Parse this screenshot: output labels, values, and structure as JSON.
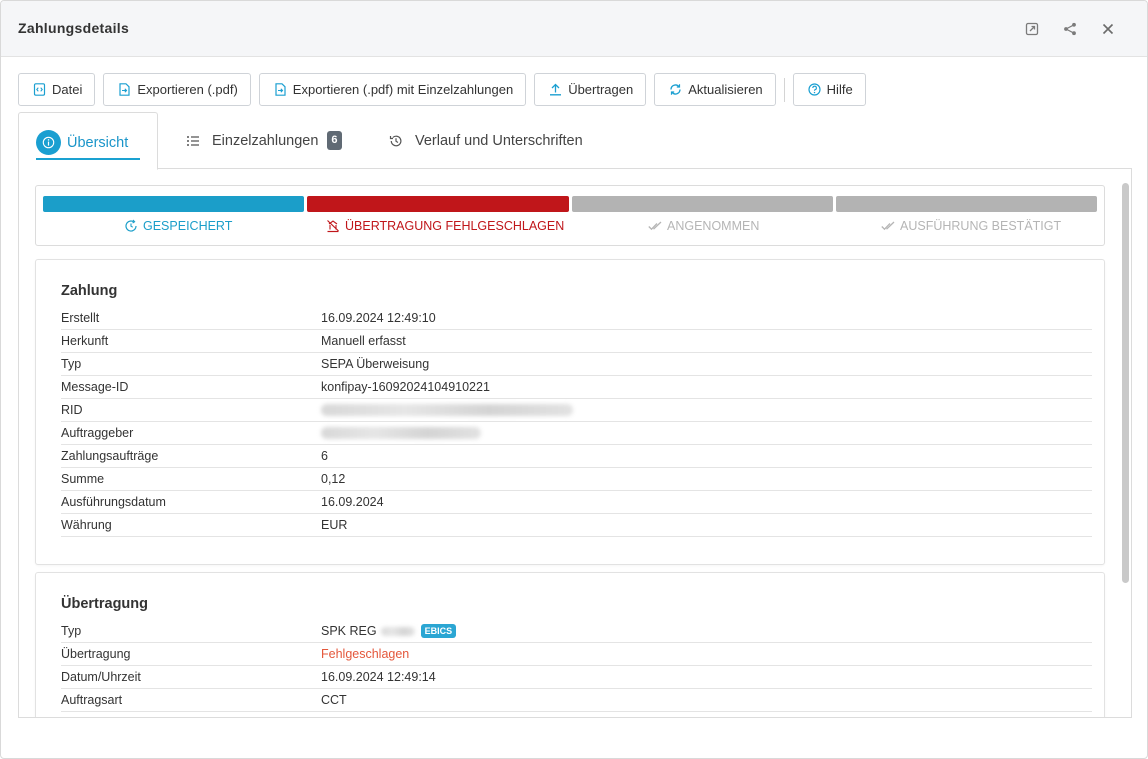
{
  "window": {
    "title": "Zahlungsdetails"
  },
  "toolbar": [
    {
      "label": "Datei",
      "icon": "file-code-icon"
    },
    {
      "label": "Exportieren (.pdf)",
      "icon": "file-export-icon"
    },
    {
      "label": "Exportieren (.pdf) mit Einzelzahlungen",
      "icon": "file-export-icon"
    },
    {
      "label": "Übertragen",
      "icon": "upload-icon"
    },
    {
      "label": "Aktualisieren",
      "icon": "refresh-icon"
    },
    {
      "label": "Hilfe",
      "icon": "help-icon"
    }
  ],
  "tabs": [
    {
      "label": "Übersicht",
      "icon": "info-icon",
      "active": true
    },
    {
      "label": "Einzelzahlungen",
      "icon": "list-icon",
      "count": "6"
    },
    {
      "label": "Verlauf und Unterschriften",
      "icon": "history-icon"
    }
  ],
  "progress": [
    {
      "label": "GESPEICHERT",
      "state": "done",
      "bar_color": "#1b9ec9",
      "text_color": "#1b9ec9",
      "icon": "saved-icon"
    },
    {
      "label": "ÜBERTRAGUNG FEHLGESCHLAGEN",
      "state": "failed",
      "bar_color": "#c0161a",
      "text_color": "#c0161a",
      "icon": "transfer-failed-icon"
    },
    {
      "label": "ANGENOMMEN",
      "state": "pending",
      "bar_color": "#b3b3b3",
      "text_color": "#b5b5b5",
      "icon": "double-check-icon"
    },
    {
      "label": "AUSFÜHRUNG BESTÄTIGT",
      "state": "pending",
      "bar_color": "#b3b3b3",
      "text_color": "#b5b5b5",
      "icon": "double-check-icon"
    }
  ],
  "zahlung": {
    "title": "Zahlung",
    "rows": [
      {
        "key": "Erstellt",
        "value": "16.09.2024 12:49:10"
      },
      {
        "key": "Herkunft",
        "value": "Manuell erfasst"
      },
      {
        "key": "Typ",
        "value": "SEPA Überweisung"
      },
      {
        "key": "Message-ID",
        "value": "konfipay-16092024104910221"
      },
      {
        "key": "RID",
        "value": "",
        "redacted": true
      },
      {
        "key": "Auftraggeber",
        "value": "",
        "redacted": true
      },
      {
        "key": "Zahlungsaufträge",
        "value": "6"
      },
      {
        "key": "Summe",
        "value": "0,12"
      },
      {
        "key": "Ausführungsdatum",
        "value": "16.09.2024"
      },
      {
        "key": "Währung",
        "value": "EUR"
      }
    ]
  },
  "uebertragung": {
    "title": "Übertragung",
    "rows": [
      {
        "key": "Typ",
        "value": "SPK REG",
        "badge": "EBICS"
      },
      {
        "key": "Übertragung",
        "value": "Fehlgeschlagen",
        "status": "error"
      },
      {
        "key": "Datum/Uhrzeit",
        "value": "16.09.2024 12:49:14"
      },
      {
        "key": "Auftragsart",
        "value": "CCT"
      }
    ]
  },
  "colors": {
    "accent": "#1a9fd1",
    "error": "#e4573b",
    "failed": "#c0161a"
  }
}
